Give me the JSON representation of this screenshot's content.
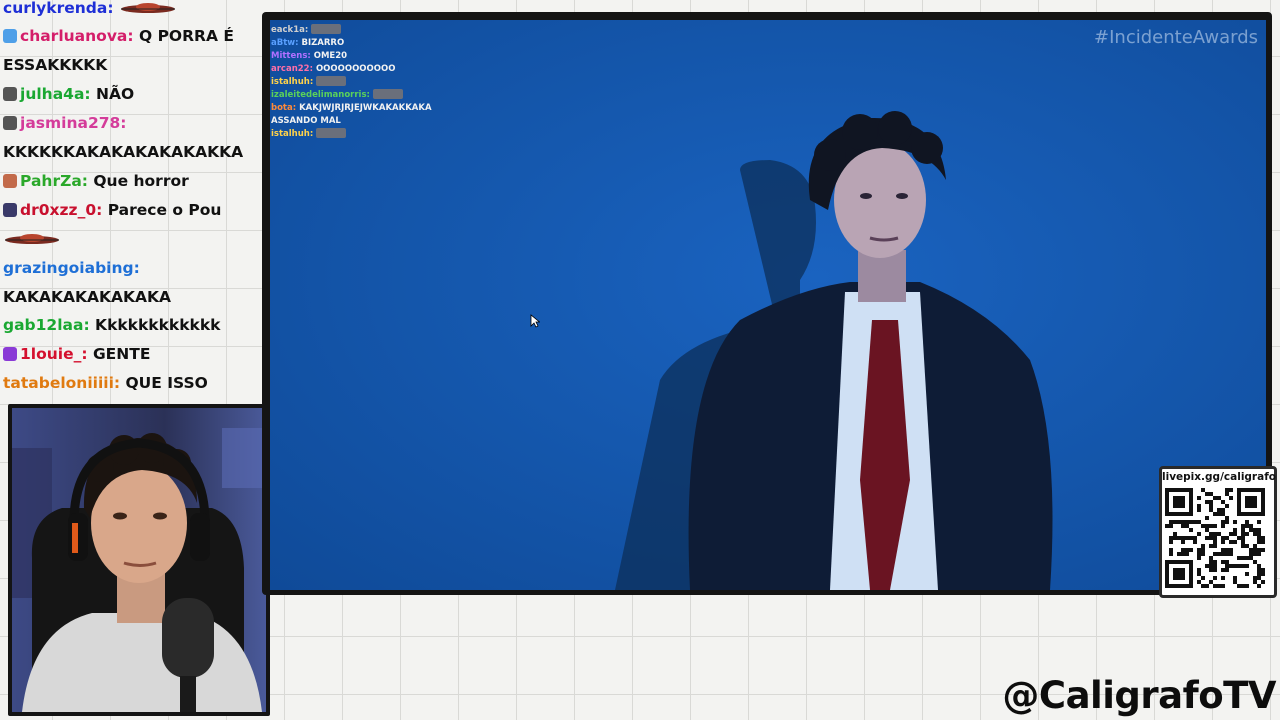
{
  "colors": {
    "page_bg": "#f3f3f1",
    "frame": "#141414",
    "stream_blue": "#1558ae",
    "handle_text": "#0d0d0d"
  },
  "chat": {
    "messages": [
      {
        "user": "curlykrenda:",
        "user_color": "#1e2fd6",
        "text": "",
        "badge": "",
        "emote": true
      },
      {
        "user": "charluanova:",
        "user_color": "#d41e6a",
        "text": "Q PORRA É",
        "badge": "#4e9fe8",
        "emote": false
      },
      {
        "user": "",
        "user_color": "#111111",
        "text": "ESSAKKKKK",
        "badge": "",
        "emote": false
      },
      {
        "user": "julha4a:",
        "user_color": "#1aa832",
        "text": "NÃO",
        "badge": "#555555",
        "emote": false
      },
      {
        "user": "jasmina278:",
        "user_color": "#d43c9a",
        "text": "",
        "badge": "#555555",
        "emote": false
      },
      {
        "user": "",
        "user_color": "#111111",
        "text": "KKKKKKAKAKAKAKAKAKKA",
        "badge": "",
        "emote": false
      },
      {
        "user": "PahrZa:",
        "user_color": "#2aa82a",
        "text": "Que horror",
        "badge": "#c26a4a",
        "emote": false
      },
      {
        "user": "dr0xzz_0:",
        "user_color": "#c8102e",
        "text": "Parece o Pou",
        "badge": "#3a3a6a",
        "emote": false
      },
      {
        "user": "",
        "user_color": "#111111",
        "text": "",
        "badge": "",
        "emote": true
      },
      {
        "user": "grazingoiabing:",
        "user_color": "#1e6fd6",
        "text": "",
        "badge": "",
        "emote": false
      },
      {
        "user": "",
        "user_color": "#111111",
        "text": "KAKAKAKAKAKAKA",
        "badge": "",
        "emote": false
      },
      {
        "user": "gab12laa:",
        "user_color": "#1aa832",
        "text": "Kkkkkkkkkkkk",
        "badge": "",
        "emote": false
      },
      {
        "user": "1louie_:",
        "user_color": "#d4102e",
        "text": "GENTE",
        "badge": "#8a3ad6",
        "emote": false
      },
      {
        "user": "tatabeloniiiii:",
        "user_color": "#e07a10",
        "text": "QUE ISSO",
        "badge": "",
        "emote": false
      }
    ]
  },
  "stream": {
    "hashtag": "#IncidenteAwards",
    "overlay_chat": [
      {
        "user": "eack1a:",
        "text": "",
        "user_color": "#cfcfcf",
        "emote": true
      },
      {
        "user": "aBtw:",
        "text": "BIZARRO",
        "user_color": "#5aa0ff",
        "emote": false
      },
      {
        "user": "Mittens:",
        "text": "OME20",
        "user_color": "#b070ff",
        "emote": false
      },
      {
        "user": "arcan22:",
        "text": "OOOOOOOOOOO",
        "user_color": "#ff6fa8",
        "emote": false
      },
      {
        "user": "istalhuh:",
        "text": "",
        "user_color": "#ffd24a",
        "emote": true
      },
      {
        "user": "izaleitedelimanorris:",
        "text": "",
        "user_color": "#5ad15a",
        "emote": true
      },
      {
        "user": "bota:",
        "text": "KAKJWJRJRJEJWKAKAKKAKA",
        "user_color": "#ff8a3a",
        "emote": false
      },
      {
        "user": "",
        "text": "ASSANDO MAL",
        "user_color": "#f2f2f2",
        "emote": false
      },
      {
        "user": "istalhuh:",
        "text": "",
        "user_color": "#ffd24a",
        "emote": true
      }
    ]
  },
  "qr": {
    "label": "livepix.gg/caligrafo"
  },
  "channel_handle": "@CaligrafoTV"
}
